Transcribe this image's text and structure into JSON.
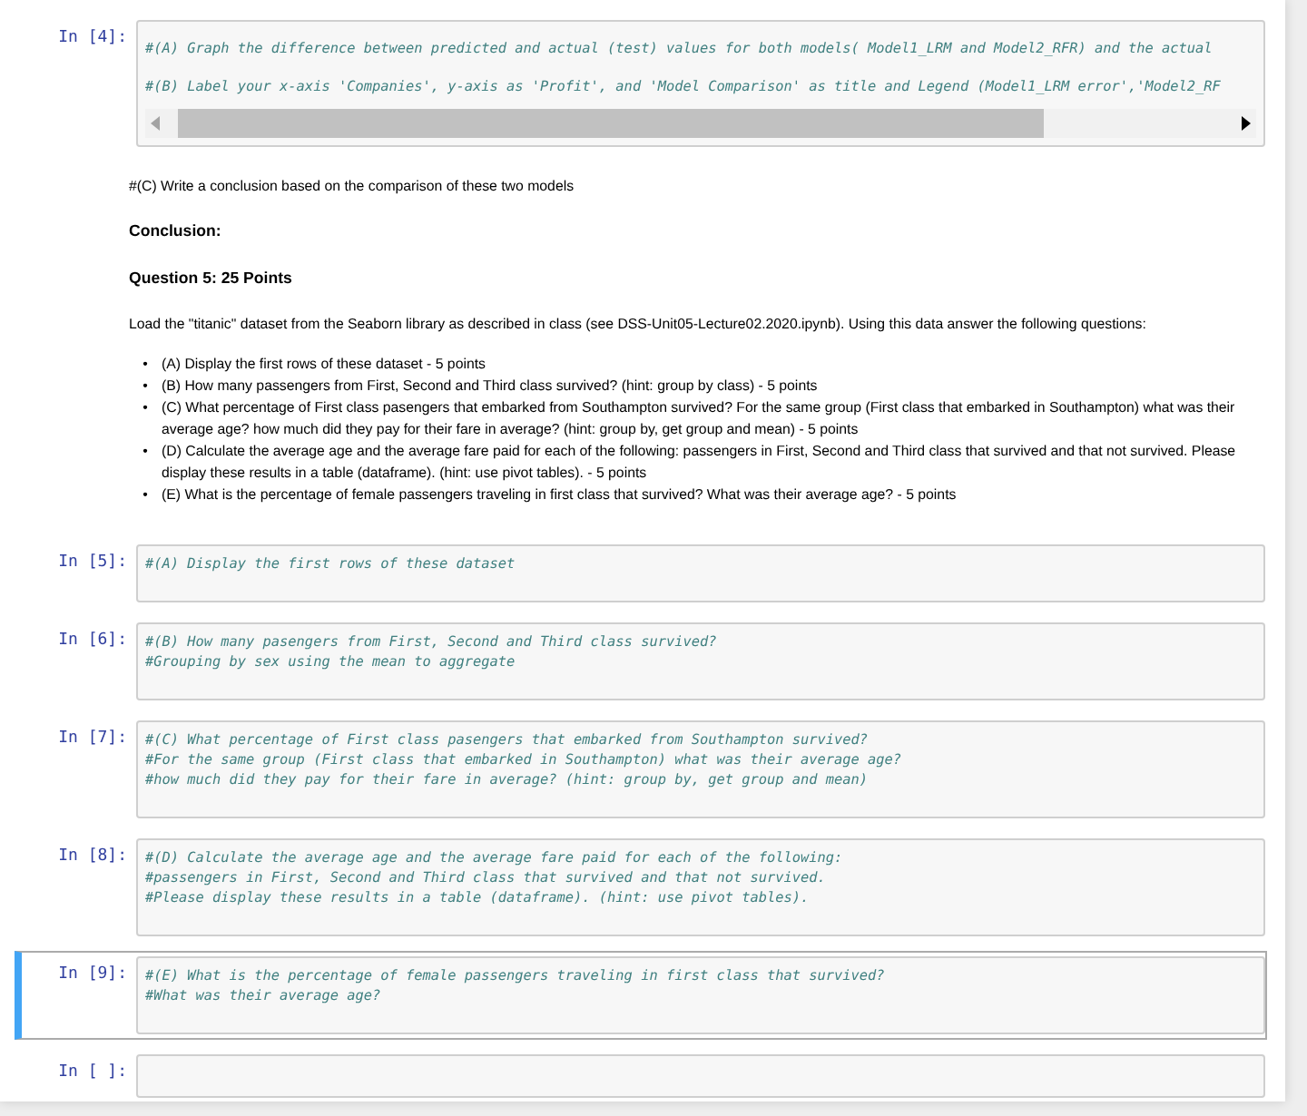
{
  "cells": [
    {
      "kind": "code",
      "prompt": "In [4]:",
      "selected": false,
      "scrollable": true,
      "lines": [
        "#(A) Graph the difference between predicted and actual (test) values for both models( Model1_LRM and Model2_RFR) and the actual",
        "#(B) Label your x-axis 'Companies', y-axis as 'Profit', and 'Model Comparison' as title and Legend (Model1_LRM error','Model2_RF"
      ]
    },
    {
      "kind": "markdown",
      "blocks": [
        {
          "kind": "paragraph",
          "text": "#(C) Write a conclusion based on the comparison of these two models"
        },
        {
          "kind": "heading",
          "text": "Conclusion:"
        },
        {
          "kind": "heading",
          "text": "Question 5: 25 Points"
        },
        {
          "kind": "paragraph",
          "text": "Load the \"titanic\" dataset from the Seaborn library as described in class (see DSS-Unit05-Lecture02.2020.ipynb). Using this data answer the following questions:"
        },
        {
          "kind": "list",
          "marker": "•",
          "items": [
            "(A) Display the first rows of these dataset - 5 points",
            "(B) How many passengers from First, Second and Third class survived? (hint: group by class) - 5 points",
            "(C) What percentage of First class pasengers that embarked from Southampton survived? For the same group (First class that embarked in Southampton) what was their average age? how much did they pay for their fare in average? (hint: group by, get group and mean) - 5 points",
            "(D) Calculate the average age and the average fare paid for each of the following: passengers in First, Second and Third class that survived and that not survived. Please display these results in a table (dataframe). (hint: use pivot tables). - 5 points",
            "(E) What is the percentage of female passengers traveling in first class that survived? What was their average age? - 5 points"
          ]
        }
      ]
    },
    {
      "kind": "code",
      "prompt": "In [5]:",
      "selected": false,
      "scrollable": false,
      "lines": [
        "#(A) Display the first rows of these dataset"
      ]
    },
    {
      "kind": "code",
      "prompt": "In [6]:",
      "selected": false,
      "scrollable": false,
      "lines": [
        "#(B) How many pasengers from First, Second and Third class survived?",
        "#Grouping by sex using the mean to aggregate"
      ]
    },
    {
      "kind": "code",
      "prompt": "In [7]:",
      "selected": false,
      "scrollable": false,
      "lines": [
        "#(C) What percentage of First class pasengers that embarked from Southampton survived?",
        "#For the same group (First class that embarked in Southampton) what was their average age?",
        "#how much did they pay for their fare in average? (hint: group by, get group and mean)"
      ]
    },
    {
      "kind": "code",
      "prompt": "In [8]:",
      "selected": false,
      "scrollable": false,
      "lines": [
        "#(D) Calculate the average age and the average fare paid for each of the following:",
        "#passengers in First, Second and Third class that survived and that not survived.",
        "#Please display these results in a table (dataframe). (hint: use pivot tables)."
      ]
    },
    {
      "kind": "code",
      "prompt": "In [9]:",
      "selected": true,
      "scrollable": false,
      "lines": [
        "#(E) What is the percentage of female passengers traveling in first class that survived?",
        "#What was their average age?"
      ]
    },
    {
      "kind": "code",
      "prompt": "In [ ]:",
      "selected": false,
      "scrollable": false
    }
  ]
}
